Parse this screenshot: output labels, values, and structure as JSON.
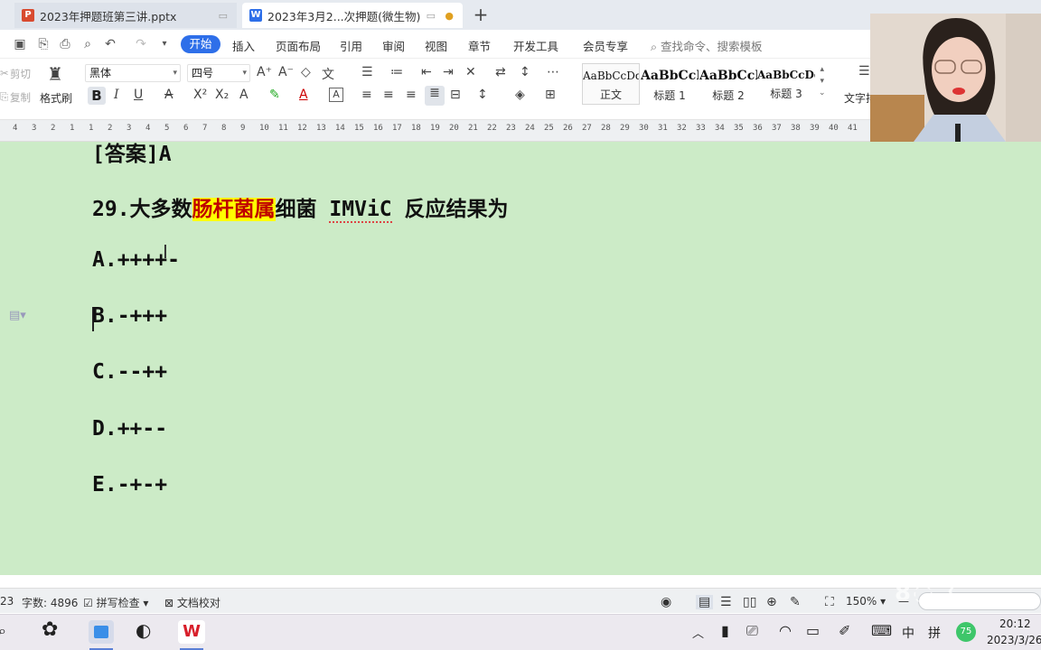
{
  "tabs": [
    {
      "label": "2023年押题班第三讲.pptx",
      "icon": "P",
      "icon_color": "#d84a2f"
    },
    {
      "label": "2023年3月2...次押题(微生物)",
      "icon": "W",
      "icon_color": "#2e6fe9"
    }
  ],
  "menu": {
    "start": "开始",
    "items": [
      "插入",
      "页面布局",
      "引用",
      "审阅",
      "视图",
      "章节",
      "开发工具",
      "会员专享"
    ],
    "search_placeholder": "查找命令、搜索模板"
  },
  "ribbon": {
    "cut": "剪切",
    "copy": "复制",
    "format_painter": "格式刷",
    "font_name": "黑体",
    "font_size": "四号",
    "styles": [
      {
        "sample": "AaBbCcDd",
        "name": "正文"
      },
      {
        "sample": "AaBbCcI",
        "name": "标题 1"
      },
      {
        "sample": "AaBbCcI",
        "name": "标题 2"
      },
      {
        "sample": "AaBbCcDd",
        "name": "标题 3"
      }
    ],
    "text_tools": "文字排"
  },
  "ruler": [
    "4",
    "3",
    "2",
    "1",
    "1",
    "2",
    "3",
    "4",
    "5",
    "6",
    "7",
    "8",
    "9",
    "10",
    "11",
    "12",
    "13",
    "14",
    "15",
    "16",
    "17",
    "18",
    "19",
    "20",
    "21",
    "22",
    "23",
    "24",
    "25",
    "26",
    "27",
    "28",
    "29",
    "30",
    "31",
    "32",
    "33",
    "34",
    "35",
    "36",
    "37",
    "38",
    "39",
    "40",
    "41"
  ],
  "document": {
    "answer_line": "[答案]A",
    "question_number": "29.",
    "question_pre": "大多数",
    "question_highlight": "肠杆菌属",
    "question_mid": "细菌 ",
    "question_term": "IMViC",
    "question_post": " 反应结果为",
    "options": [
      "A.++++-",
      "B.-+++",
      "C.--++",
      "D.++--",
      "E.-+-+"
    ]
  },
  "status": {
    "page": "23",
    "word_count": "字数: 4896",
    "spell_check": "拼写检查",
    "doc_review": "文档校对",
    "zoom": "150%"
  },
  "taskbar": {
    "ime_lang": "中",
    "ime_mode": "拼",
    "badge": "75",
    "time": "20:12",
    "date": "2023/3/26"
  },
  "colors": {
    "accent": "#2e6fe9",
    "doc_bg": "#ccebc7",
    "highlight": "#ffff00",
    "highlight_text": "#c00000"
  }
}
